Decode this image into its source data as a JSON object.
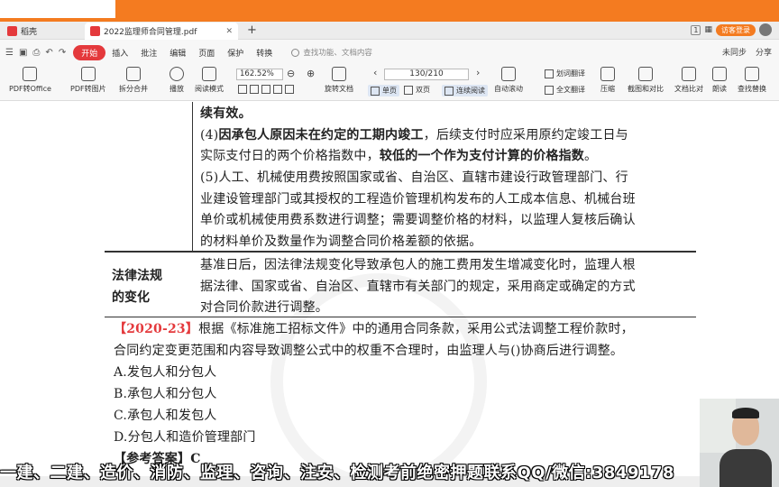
{
  "tabs": [
    {
      "label": "稻壳"
    },
    {
      "label": "2022监理师合同管理.pdf"
    }
  ],
  "tabbar_right": {
    "num": "1",
    "visit": "访客登录"
  },
  "menu": {
    "items": [
      "开始",
      "插入",
      "批注",
      "编辑",
      "页面",
      "保护",
      "转换"
    ],
    "search_placeholder": "查找功能、文档内容",
    "right": [
      "未同步",
      "分享"
    ]
  },
  "toolbar": {
    "buttons": [
      "PDF转Office",
      "PDF转图片",
      "拆分合并",
      "播放",
      "阅读模式",
      "旋转文档",
      "单页",
      "双页",
      "连续阅读",
      "自动滚动",
      "划词翻译",
      "全文翻译",
      "压缩",
      "截图和对比",
      "文档比对",
      "朗读",
      "查找替换"
    ],
    "zoom": "162.52%",
    "page": "130/210"
  },
  "document": {
    "l1": "续有效。",
    "l2_pre": "(4)",
    "l2_bold": "因承包人原因未在约定的工期内竣工",
    "l2_post": "，后续支付时应采用原约定竣工日与",
    "l3_pre": "实际支付日的两个价格指数中，",
    "l3_bold": "较低的一个作为支付计算的价格指数",
    "l3_post": "。",
    "l4": "(5)人工、机械使用费按照国家或省、自治区、直辖市建设行政管理部门、行",
    "l5": "业建设管理部门或其授权的工程造价管理机构发布的人工成本信息、机械台班",
    "l6": "单价或机械使用费系数进行调整；需要调整价格的材料，以监理人复核后确认",
    "l7": "的材料单价及数量作为调整合同价格差额的依据。",
    "legal_label_1": "法律法规",
    "legal_label_2": "的变化",
    "legal_l1": "基准日后，因法律法规变化导致承包人的施工费用发生增减变化时，监理人根",
    "legal_l2": "据法律、国家或省、自治区、直辖市有关部门的规定，采用商定或确定的方式",
    "legal_l3": "对合同价款进行调整。",
    "q_tag": "【2020-23】",
    "q_text": "根据《标准施工招标文件》中的通用合同条款，采用公式法调整工程价款时，",
    "q_text2": "合同约定变更范围和内容导致调整公式中的权重不合理时，由监理人与()协商后进行调整。",
    "opt_a": "A.发包人和分包人",
    "opt_b": "B.承包人和分包人",
    "opt_c": "C.承包人和发包人",
    "opt_d": "D.分包人和造价管理部门",
    "answer": "【参考答案】C"
  },
  "banner": "一建、二建、造价、消防、监理、咨询、注安、检测考前绝密押题联系QQ/微信:3849178"
}
